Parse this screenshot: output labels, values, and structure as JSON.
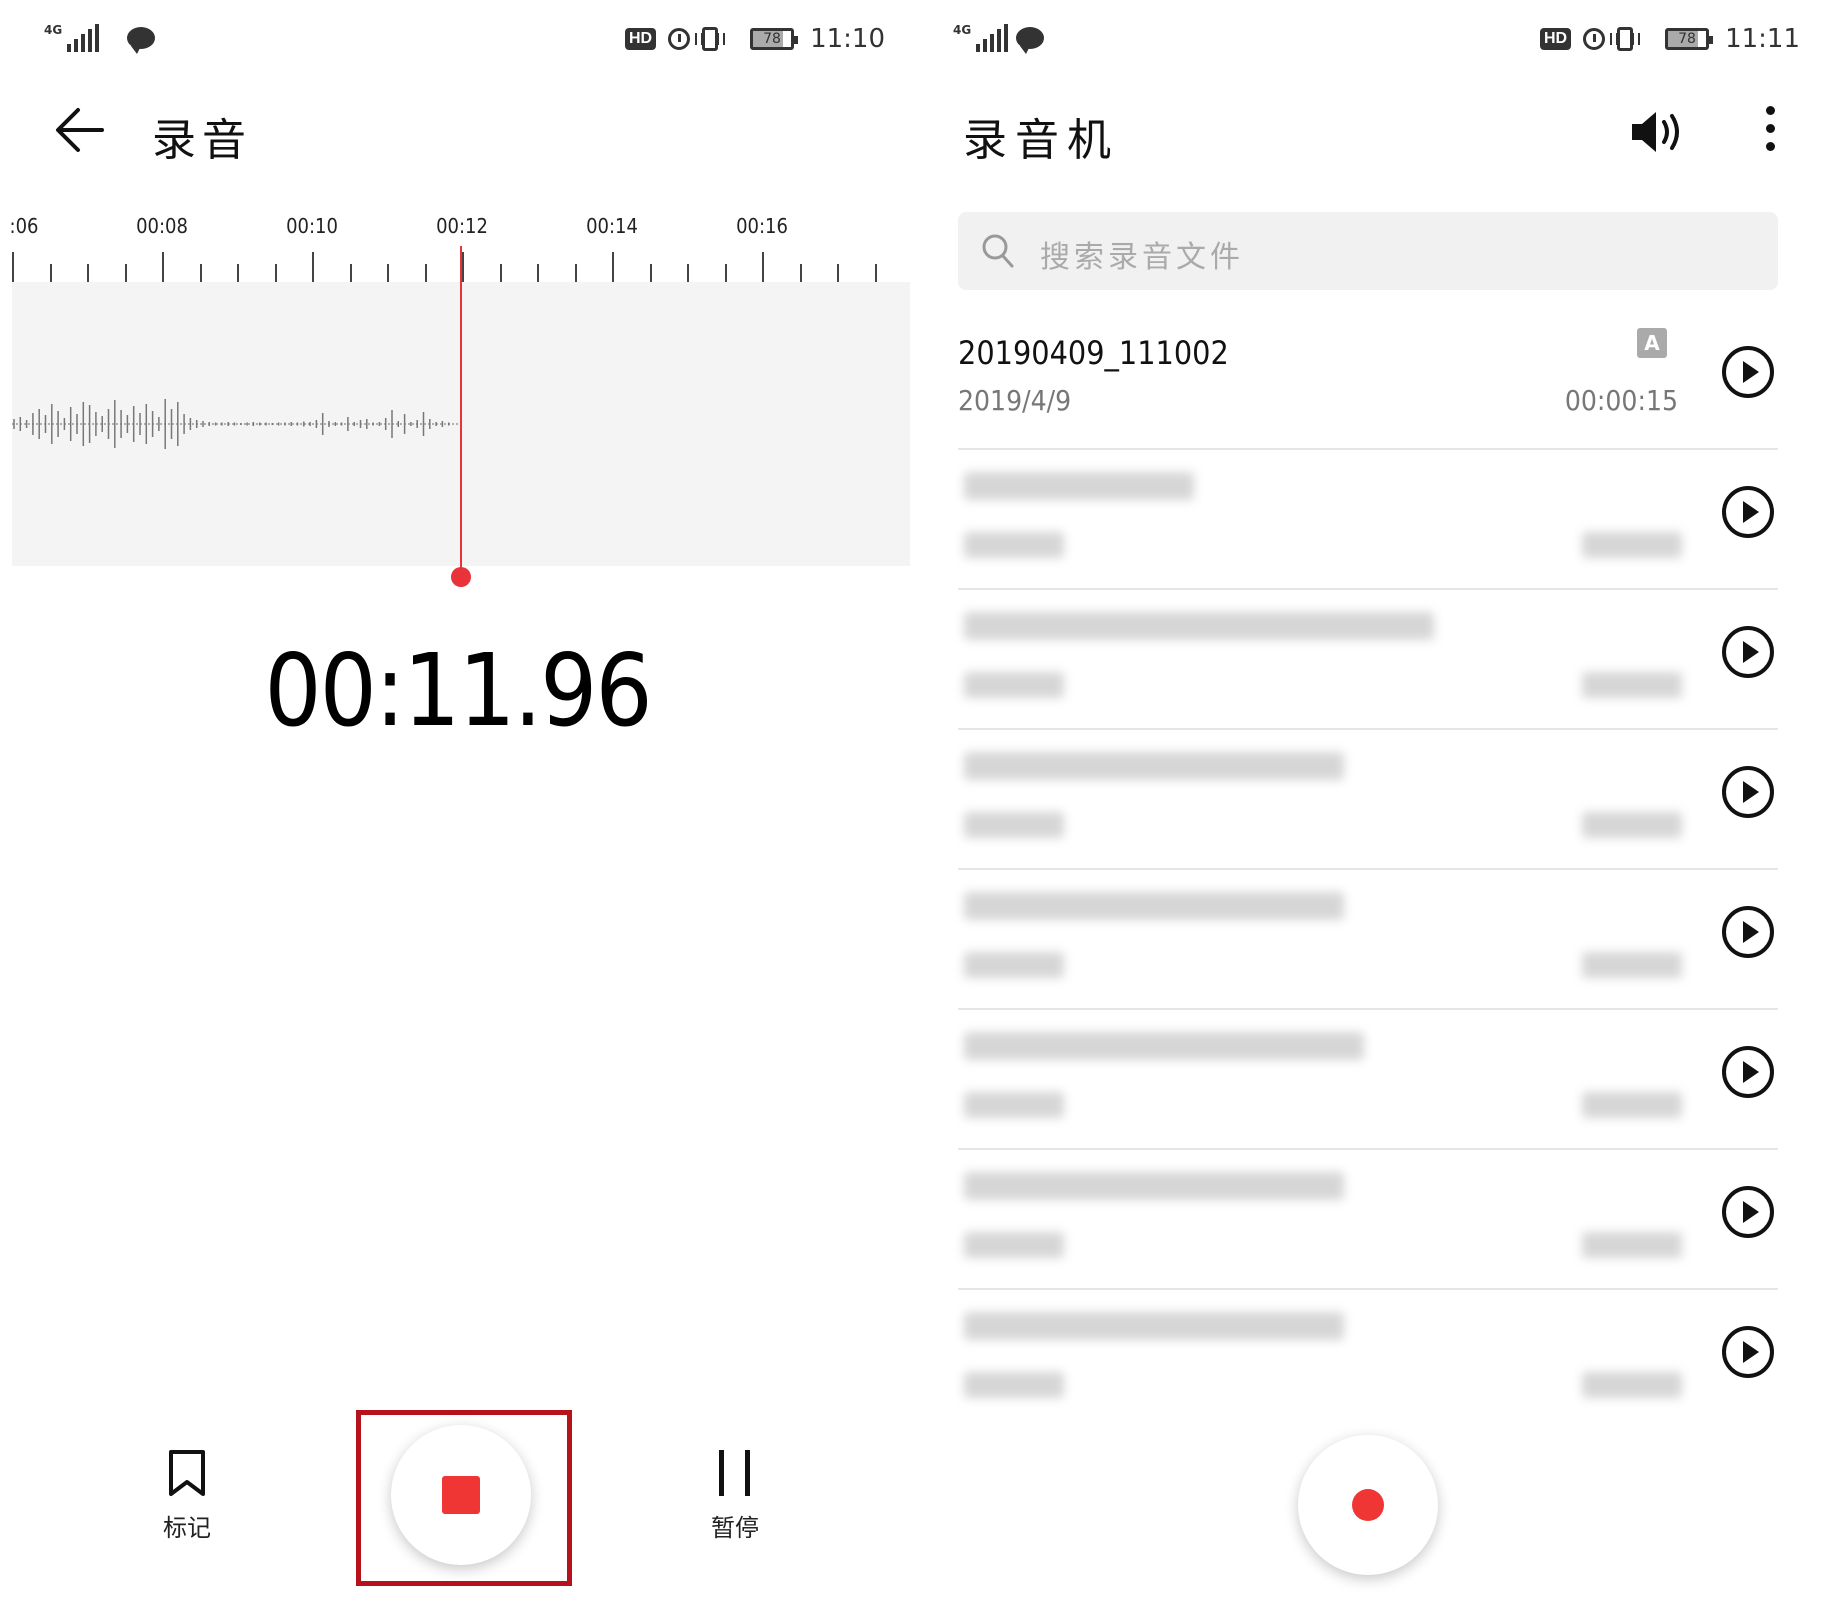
{
  "left": {
    "status": {
      "network": "4G",
      "battery": "78",
      "battery_level": 0.78,
      "time": "11:10"
    },
    "title": "录音",
    "timeline": {
      "labels": [
        ":06",
        "00:08",
        "00:10",
        "00:12",
        "00:14",
        "00:16"
      ]
    },
    "timer": "00:11.96",
    "controls": {
      "mark_label": "标记",
      "pause_label": "暂停"
    },
    "colors": {
      "accent": "#e8333a",
      "highlight_box": "#b5121b"
    }
  },
  "right": {
    "status": {
      "network": "4G",
      "battery": "78",
      "battery_level": 0.78,
      "time": "11:11"
    },
    "title": "录音机",
    "search": {
      "placeholder": "搜索录音文件"
    },
    "recordings": [
      {
        "name": "20190409_111002",
        "date": "2019/4/9",
        "duration": "00:00:15",
        "badge": "A"
      }
    ],
    "blurred_item_count": 7
  }
}
